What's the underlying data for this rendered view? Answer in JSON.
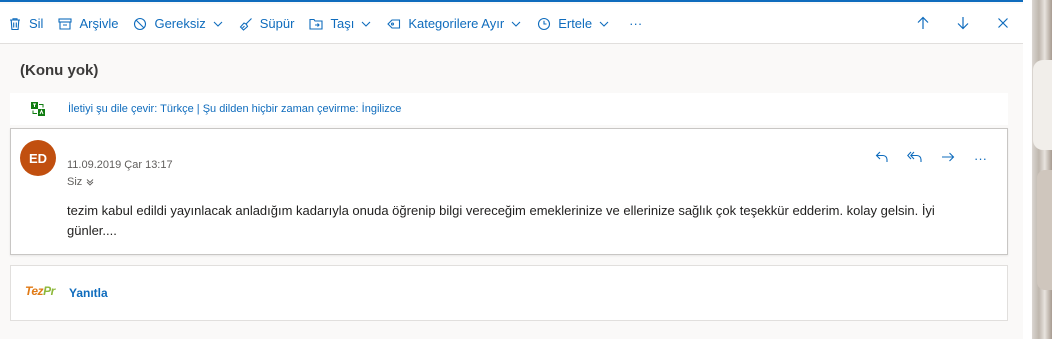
{
  "toolbar": {
    "items": [
      {
        "label": "Sil",
        "icon": "trash-icon"
      },
      {
        "label": "Arşivle",
        "icon": "archive-icon"
      },
      {
        "label": "Gereksiz",
        "icon": "block-icon",
        "dropdown": true
      },
      {
        "label": "Süpür",
        "icon": "broom-icon"
      },
      {
        "label": "Taşı",
        "icon": "move-folder-icon",
        "dropdown": true
      },
      {
        "label": "Kategorilere Ayır",
        "icon": "tag-icon",
        "dropdown": true
      },
      {
        "label": "Ertele",
        "icon": "clock-icon",
        "dropdown": true
      }
    ],
    "more_label": "···",
    "right_icons": [
      "arrow-up-icon",
      "arrow-down-icon",
      "close-icon"
    ]
  },
  "subject": "(Konu yok)",
  "translate_bar": {
    "icon": "translate-icon",
    "text": "İletiyi şu dile çevir: Türkçe | Şu dilden hiçbir zaman çevirme: İngilizce"
  },
  "message": {
    "avatar_initials": "ED",
    "avatar_color": "#c14f0f",
    "date": "11.09.2019 Çar 13:17",
    "to": "Siz",
    "body": "tezim kabul edildi yayınlacak anladığım kadarıyla onuda öğrenip bilgi vereceğim emeklerinize ve ellerinize sağlık çok teşekkür edderim. kolay gelsin. İyi günler....",
    "actions": [
      "reply-icon",
      "reply-all-icon",
      "forward-icon",
      "more-icon"
    ],
    "more_label": "···"
  },
  "reply": {
    "logo_text_a": "Tez",
    "logo_text_b": "Pr",
    "link_label": "Yanıtla"
  },
  "colors": {
    "accent": "#0f6cbd",
    "pane_bg": "#faf9f8"
  }
}
